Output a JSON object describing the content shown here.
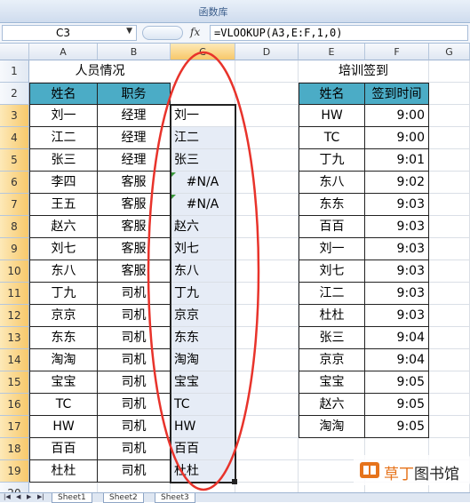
{
  "ribbon": {
    "group_label": "函数库"
  },
  "formula_bar": {
    "name_box": "C3",
    "fx_icon": "fx",
    "formula": "=VLOOKUP(A3,E:F,1,0)"
  },
  "columns": [
    "A",
    "B",
    "C",
    "D",
    "E",
    "F",
    "G"
  ],
  "rows": [
    "1",
    "2",
    "3",
    "4",
    "5",
    "6",
    "7",
    "8",
    "9",
    "10",
    "11",
    "12",
    "13",
    "14",
    "15",
    "16",
    "17",
    "18",
    "19",
    "20"
  ],
  "selected_cell": "C3",
  "table_left": {
    "title": "人员情况",
    "headers": [
      "姓名",
      "职务"
    ],
    "rows": [
      [
        "刘一",
        "经理"
      ],
      [
        "江二",
        "经理"
      ],
      [
        "张三",
        "经理"
      ],
      [
        "李四",
        "客服"
      ],
      [
        "王五",
        "客服"
      ],
      [
        "赵六",
        "客服"
      ],
      [
        "刘七",
        "客服"
      ],
      [
        "东八",
        "客服"
      ],
      [
        "丁九",
        "司机"
      ],
      [
        "京京",
        "司机"
      ],
      [
        "东东",
        "司机"
      ],
      [
        "淘淘",
        "司机"
      ],
      [
        "宝宝",
        "司机"
      ],
      [
        "TC",
        "司机"
      ],
      [
        "HW",
        "司机"
      ],
      [
        "百百",
        "司机"
      ],
      [
        "杜杜",
        "司机"
      ]
    ]
  },
  "column_c": [
    "刘一",
    "江二",
    "张三",
    "#N/A",
    "#N/A",
    "赵六",
    "刘七",
    "东八",
    "丁九",
    "京京",
    "东东",
    "淘淘",
    "宝宝",
    "TC",
    "HW",
    "百百",
    "杜杜"
  ],
  "table_right": {
    "title": "培训签到",
    "headers": [
      "姓名",
      "签到时间"
    ],
    "rows": [
      [
        "HW",
        "9:00"
      ],
      [
        "TC",
        "9:00"
      ],
      [
        "丁九",
        "9:01"
      ],
      [
        "东八",
        "9:02"
      ],
      [
        "东东",
        "9:03"
      ],
      [
        "百百",
        "9:03"
      ],
      [
        "刘一",
        "9:03"
      ],
      [
        "刘七",
        "9:03"
      ],
      [
        "江二",
        "9:03"
      ],
      [
        "杜杜",
        "9:03"
      ],
      [
        "张三",
        "9:04"
      ],
      [
        "京京",
        "9:04"
      ],
      [
        "宝宝",
        "9:05"
      ],
      [
        "赵六",
        "9:05"
      ],
      [
        "淘淘",
        "9:05"
      ]
    ]
  },
  "sheet_tabs": [
    "Sheet1",
    "Sheet2",
    "Sheet3"
  ],
  "watermark": {
    "prefix": "草丁",
    "suffix": "图书馆"
  },
  "colors": {
    "header_fill": "#4bacc6",
    "annotation": "#e8332b",
    "selection_header": "#f7c86a"
  }
}
